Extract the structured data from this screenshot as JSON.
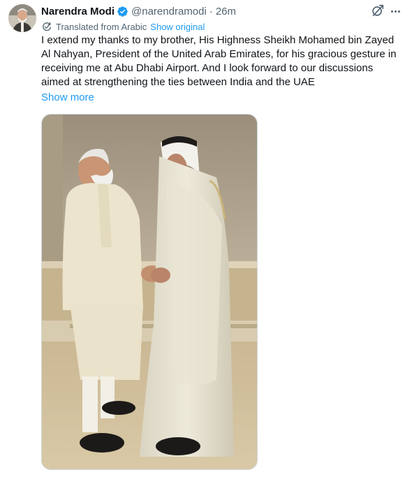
{
  "tweet": {
    "author_name": "Narendra Modi",
    "handle": "@narendramodi",
    "separator": "·",
    "time": "26m",
    "translated_label": "Translated from Arabic",
    "show_original": "Show original",
    "text": "I extend my thanks to my brother, His Highness Sheikh Mohamed bin Zayed Al Nahyan, President of the United Arab Emirates, for his gracious gesture in receiving me at Abu Dhabi Airport. And I look forward to our discussions aimed at strengthening the ties between India and the UAE",
    "show_more": "Show more"
  },
  "icons": {
    "verified": "verified-badge-icon",
    "grok": "grok-icon",
    "more": "more-icon",
    "translate": "translate-icon"
  },
  "colors": {
    "link": "#1d9bf0",
    "secondary_text": "#536471",
    "verified_badge": "#1d9bf0"
  }
}
